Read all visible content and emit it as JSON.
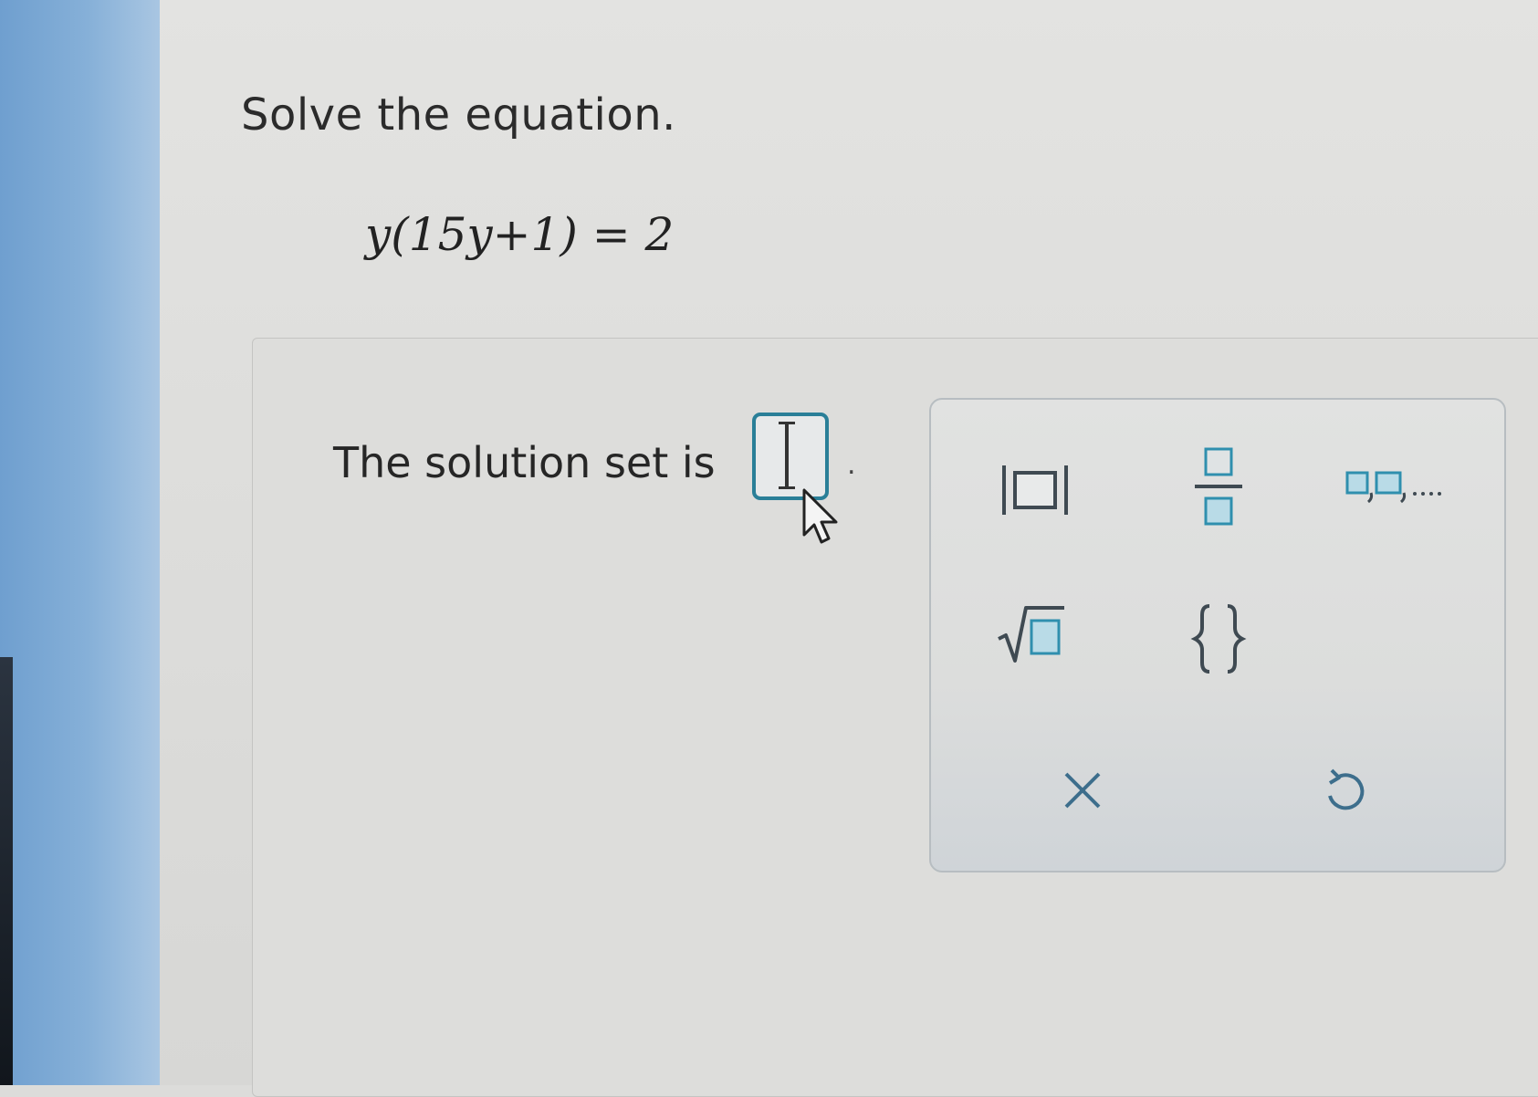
{
  "question": {
    "instruction": "Solve the equation.",
    "equation": "y(15y+1) = 2"
  },
  "answer": {
    "prompt": "The solution set is",
    "trailing_punctuation": ".",
    "input_value": ""
  },
  "palette": {
    "buttons": [
      {
        "name": "absolute-value",
        "icon": "absolute-value-template-icon"
      },
      {
        "name": "fraction",
        "icon": "fraction-template-icon"
      },
      {
        "name": "list",
        "icon": "comma-list-template-icon",
        "glyph": "...."
      },
      {
        "name": "square-root",
        "icon": "square-root-template-icon",
        "glyph": "√"
      },
      {
        "name": "set-braces",
        "icon": "set-braces-icon",
        "glyph": "{}"
      },
      {
        "name": "clear",
        "icon": "clear-x-icon",
        "glyph": "×"
      },
      {
        "name": "undo",
        "icon": "undo-icon",
        "glyph": "↺"
      }
    ]
  },
  "colors": {
    "accent": "#2a7f98",
    "template_fill": "#b9dbe7",
    "sidebar": "#86b0d8"
  }
}
